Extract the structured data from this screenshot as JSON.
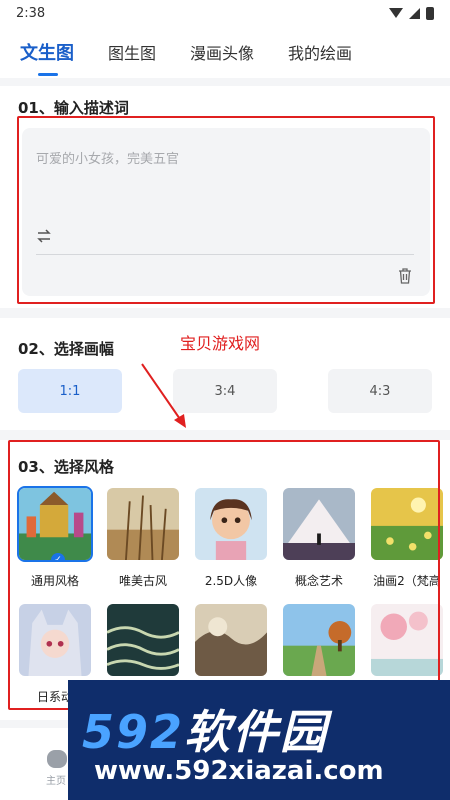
{
  "status_bar": {
    "time": "2:38"
  },
  "tabs": [
    {
      "label": "文生图",
      "active": true
    },
    {
      "label": "图生图",
      "active": false
    },
    {
      "label": "漫画头像",
      "active": false
    },
    {
      "label": "我的绘画",
      "active": false
    }
  ],
  "section1": {
    "title": "01、输入描述词",
    "placeholder": "可爱的小女孩，完美五官"
  },
  "section2": {
    "title": "02、选择画幅",
    "ratios": [
      {
        "label": "1:1",
        "selected": true
      },
      {
        "label": "3:4",
        "selected": false
      },
      {
        "label": "4:3",
        "selected": false
      }
    ]
  },
  "section3": {
    "title": "03、选择风格",
    "row1": [
      {
        "label": "通用风格",
        "icon": "fantasy-castle-image",
        "selected": true
      },
      {
        "label": "唯美古风",
        "icon": "reeds-field-image",
        "selected": false
      },
      {
        "label": "2.5D人像",
        "icon": "cartoon-girl-image",
        "selected": false
      },
      {
        "label": "概念艺术",
        "icon": "mountain-figure-image",
        "selected": false
      },
      {
        "label": "油画2（梵高",
        "icon": "oil-painting-field-image",
        "selected": false
      }
    ],
    "row2": [
      {
        "label": "日系动",
        "icon": "anime-fox-girl-image"
      },
      {
        "label": "",
        "icon": "ocean-waves-image"
      },
      {
        "label": "",
        "icon": "ink-clouds-image"
      },
      {
        "label": "",
        "icon": "park-path-image"
      },
      {
        "label": "",
        "icon": "sakura-painting-image"
      }
    ]
  },
  "annotation": {
    "text": "宝贝游戏网",
    "color": "#e02020"
  },
  "bottom_nav": {
    "home_label": "主页"
  },
  "watermark": {
    "logo_num": "592",
    "logo_text": "软件园",
    "url": "www.592xiazai.com"
  },
  "colors": {
    "accent": "#1a73e8",
    "frame": "#e02020"
  }
}
